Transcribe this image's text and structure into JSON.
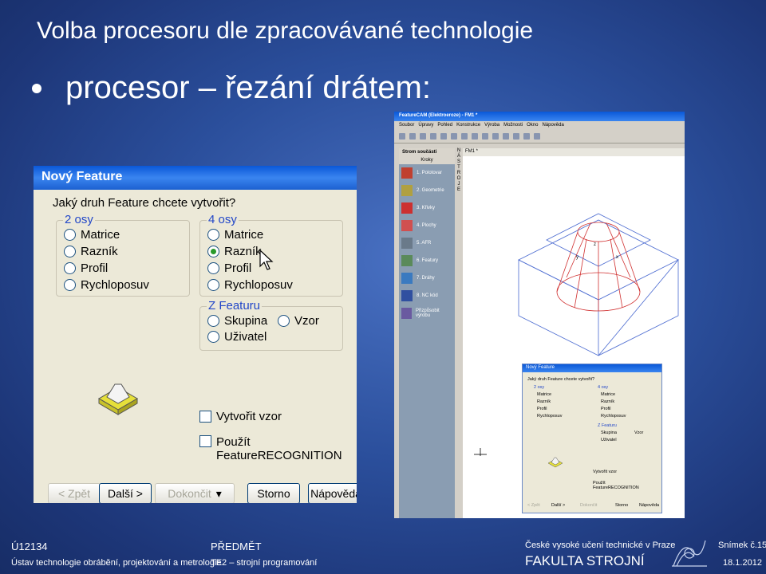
{
  "slide": {
    "title": "Volba procesoru dle zpracovávané technologie",
    "bullet": "procesor – řezání drátem:"
  },
  "dialog": {
    "title": "Nový Feature",
    "question": "Jaký druh Feature chcete vytvořit?",
    "group_2axis": {
      "label": "2 osy",
      "options": [
        "Matrice",
        "Razník",
        "Profil",
        "Rychloposuv"
      ]
    },
    "group_4axis": {
      "label": "4 osy",
      "options": [
        "Matrice",
        "Razník",
        "Profil",
        "Rychloposuv"
      ],
      "selected": "Razník"
    },
    "group_z": {
      "label": "Z Featuru",
      "options": [
        "Skupina",
        "Vzor",
        "Uživatel"
      ]
    },
    "checkbox_pattern": "Vytvořit vzor",
    "checkbox_recognition": "Použít FeatureRECOGNITION",
    "buttons": {
      "back": "< Zpět",
      "next": "Další >",
      "finish": "Dokončit",
      "cancel": "Storno",
      "help": "Nápověda"
    }
  },
  "app": {
    "title": "FeatureCAM (Elektroeroze) - FM1 *",
    "menu": [
      "Soubor",
      "Úpravy",
      "Pohled",
      "Konstrukce",
      "Výroba",
      "Možnosti",
      "Okno",
      "Nápověda"
    ],
    "panel_head": "Strom součásti",
    "panel_tab": "Kroky",
    "steps": [
      "1. Polotovar",
      "2. Geometrie",
      "3. Křivky",
      "4. Plochy",
      "5. AFR",
      "6. Featury",
      "7. Dráhy",
      "8. NC kód",
      "Přizpůsobit výrobu"
    ],
    "vertical_label": "NÁSTROJE",
    "view_tab": "FM1 *",
    "axis_labels": {
      "y": "y",
      "z": "z",
      "x": "x"
    }
  },
  "footer": {
    "code": "Ú12134",
    "institute": "Ústav technologie obrábění, projektování a metrologie",
    "subject_label": "PŘEDMĚT",
    "subject": "TE2 – strojní programování",
    "university": "České vysoké učení technické v Praze",
    "faculty": "FAKULTA STROJNÍ",
    "slide_no": "Snímek č.15",
    "date": "18.1.2012"
  }
}
